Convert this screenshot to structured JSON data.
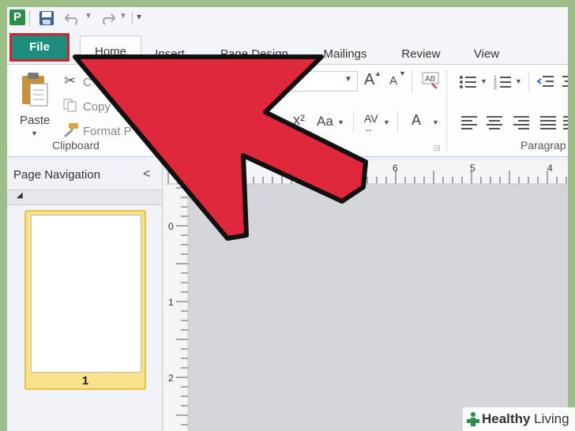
{
  "app": {
    "icon_letter": "P"
  },
  "tabs": [
    {
      "label": "File"
    },
    {
      "label": "Home"
    },
    {
      "label": "Insert"
    },
    {
      "label": "Page Design"
    },
    {
      "label": "Mailings"
    },
    {
      "label": "Review"
    },
    {
      "label": "View"
    }
  ],
  "clipboard": {
    "paste_label": "Paste",
    "cut_label": "C",
    "copy_label": "Copy",
    "format_painter_label": "Format P",
    "group_label": "Clipboard"
  },
  "font": {
    "superscript_glyph": "x²",
    "font_size_grow": "A",
    "font_size_shrink": "A",
    "change_case": "Aa",
    "char_spacing": "AV",
    "font_color": "A"
  },
  "paragraph": {
    "group_label": "Paragrap"
  },
  "navigation": {
    "title": "Page Navigation",
    "collapse_glyph": "<",
    "pages": [
      {
        "number": "1"
      }
    ]
  },
  "ruler": {
    "horizontal_labels": [
      "6",
      "5",
      "4"
    ],
    "vertical_labels": [
      "0",
      "1",
      "2"
    ]
  },
  "watermark": {
    "brand_bold": "Healthy",
    "brand_rest": " Living"
  },
  "colors": {
    "file_tab": "#1e8c7d",
    "highlight_border": "#d5222e",
    "arrow_fill": "#e0283c",
    "arrow_stroke": "#111111",
    "selected_thumb": "#f9e08b"
  }
}
